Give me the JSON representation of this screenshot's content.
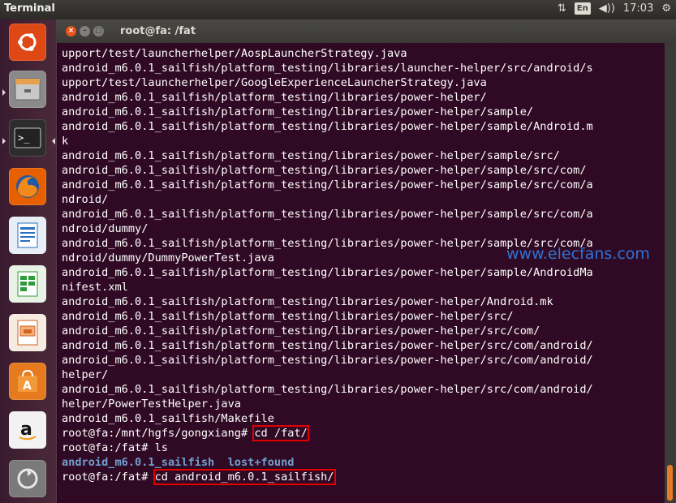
{
  "topbar": {
    "app_title": "Terminal",
    "network_icon": "⇅",
    "keyboard_layout": "En",
    "volume_icon": "◀))",
    "clock": "17:03",
    "settings_icon": "⚙"
  },
  "launcher": {
    "items": [
      {
        "name": "ubuntu-dash-icon"
      },
      {
        "name": "files-icon"
      },
      {
        "name": "terminal-icon"
      },
      {
        "name": "firefox-icon"
      },
      {
        "name": "libreoffice-writer-icon"
      },
      {
        "name": "libreoffice-calc-icon"
      },
      {
        "name": "libreoffice-impress-icon"
      },
      {
        "name": "software-center-icon"
      },
      {
        "name": "amazon-icon"
      },
      {
        "name": "updates-icon"
      }
    ]
  },
  "window": {
    "title": "root@fa: /fat"
  },
  "terminal": {
    "lines": [
      {
        "text": "upport/test/launcherhelper/AospLauncherStrategy.java"
      },
      {
        "text": "android_m6.0.1_sailfish/platform_testing/libraries/launcher-helper/src/android/s"
      },
      {
        "text": "upport/test/launcherhelper/GoogleExperienceLauncherStrategy.java"
      },
      {
        "text": "android_m6.0.1_sailfish/platform_testing/libraries/power-helper/"
      },
      {
        "text": "android_m6.0.1_sailfish/platform_testing/libraries/power-helper/sample/"
      },
      {
        "text": "android_m6.0.1_sailfish/platform_testing/libraries/power-helper/sample/Android.m"
      },
      {
        "text": "k"
      },
      {
        "text": "android_m6.0.1_sailfish/platform_testing/libraries/power-helper/sample/src/"
      },
      {
        "text": "android_m6.0.1_sailfish/platform_testing/libraries/power-helper/sample/src/com/"
      },
      {
        "text": "android_m6.0.1_sailfish/platform_testing/libraries/power-helper/sample/src/com/a"
      },
      {
        "text": "ndroid/"
      },
      {
        "text": "android_m6.0.1_sailfish/platform_testing/libraries/power-helper/sample/src/com/a"
      },
      {
        "text": "ndroid/dummy/"
      },
      {
        "text": "android_m6.0.1_sailfish/platform_testing/libraries/power-helper/sample/src/com/a"
      },
      {
        "text": "ndroid/dummy/DummyPowerTest.java"
      },
      {
        "text": "android_m6.0.1_sailfish/platform_testing/libraries/power-helper/sample/AndroidMa"
      },
      {
        "text": "nifest.xml"
      },
      {
        "text": "android_m6.0.1_sailfish/platform_testing/libraries/power-helper/Android.mk"
      },
      {
        "text": "android_m6.0.1_sailfish/platform_testing/libraries/power-helper/src/"
      },
      {
        "text": "android_m6.0.1_sailfish/platform_testing/libraries/power-helper/src/com/"
      },
      {
        "text": "android_m6.0.1_sailfish/platform_testing/libraries/power-helper/src/com/android/"
      },
      {
        "text": "android_m6.0.1_sailfish/platform_testing/libraries/power-helper/src/com/android/"
      },
      {
        "text": "helper/"
      },
      {
        "text": "android_m6.0.1_sailfish/platform_testing/libraries/power-helper/src/com/android/"
      },
      {
        "text": "helper/PowerTestHelper.java"
      },
      {
        "text": "android_m6.0.1_sailfish/Makefile"
      }
    ],
    "prompt1": "root@fa:/mnt/hgfs/gongxiang# ",
    "cmd1": "cd /fat/",
    "prompt2": "root@fa:/fat# ",
    "cmd2": "ls",
    "ls_dir1": "android_m6.0.1_sailfish",
    "ls_dir2": "lost+found",
    "prompt3": "root@fa:/fat# ",
    "cmd3": "cd android_m6.0.1_sailfish/"
  },
  "watermark": "www.elecfans.com",
  "colors": {
    "terminal_bg": "#300a24",
    "directory": "#729fcf",
    "highlight_box": "#e00000",
    "scroll_thumb": "#e57a28"
  }
}
